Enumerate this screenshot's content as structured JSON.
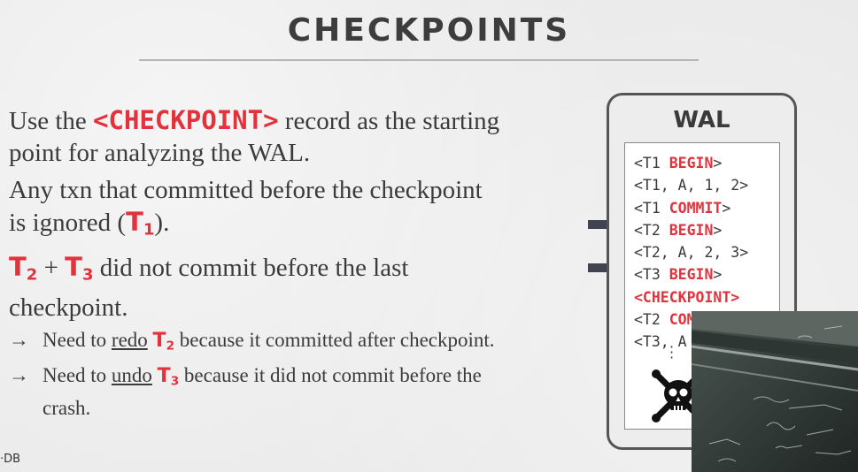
{
  "slide": {
    "title": "CHECKPOINTS",
    "footer_logo": "·DB"
  },
  "bullets": {
    "b1_pre": "Use the ",
    "b1_kw": "<CHECKPOINT>",
    "b1_post": " record as the starting point for analyzing the WAL.",
    "b2_pre": "Any txn that committed before the checkpoint is ignored (",
    "b2_txn": "T",
    "b2_txn_sub": "1",
    "b2_post": ").",
    "b3_t2": "T",
    "b3_t2_sub": "2",
    "b3_plus": " + ",
    "b3_t3": "T",
    "b3_t3_sub": "3",
    "b3_post": " did not commit before the last checkpoint.",
    "arrow": "→",
    "s1_pre": "Need to ",
    "s1_u": "redo",
    "s1_txn": "T",
    "s1_txn_sub": "2",
    "s1_post": " because it committed after checkpoint.",
    "s2_pre": "Need to ",
    "s2_u": "undo",
    "s2_txn": "T",
    "s2_txn_sub": "3",
    "s2_post": " because it did not commit before the crash."
  },
  "wal": {
    "title": "WAL",
    "line1_a": "<T1 ",
    "line1_kw": "BEGIN",
    "line1_b": ">",
    "line2": "<T1, A, 1, 2>",
    "line3_a": "<T1 ",
    "line3_kw": "COMMIT",
    "line3_b": ">",
    "line4_a": "<T2 ",
    "line4_kw": "BEGIN",
    "line4_b": ">",
    "line5": "<T2, A, 2, 3>",
    "line6_a": "<T3 ",
    "line6_kw": "BEGIN",
    "line6_b": ">",
    "line7_kw": "<CHECKPOINT>",
    "line8_a": "<T2 ",
    "line8_kw": "COMMIT",
    "line8_b": ">",
    "line9": "<T3, A",
    "crash_icon": "skull-crossbones-icon",
    "pointer_icon": "arrow-right-icon"
  },
  "colors": {
    "keyword": "#e3323b",
    "text": "#3b3b3b",
    "arrow": "#3f4450"
  },
  "webcam": {
    "description_icon": "video-feed"
  }
}
